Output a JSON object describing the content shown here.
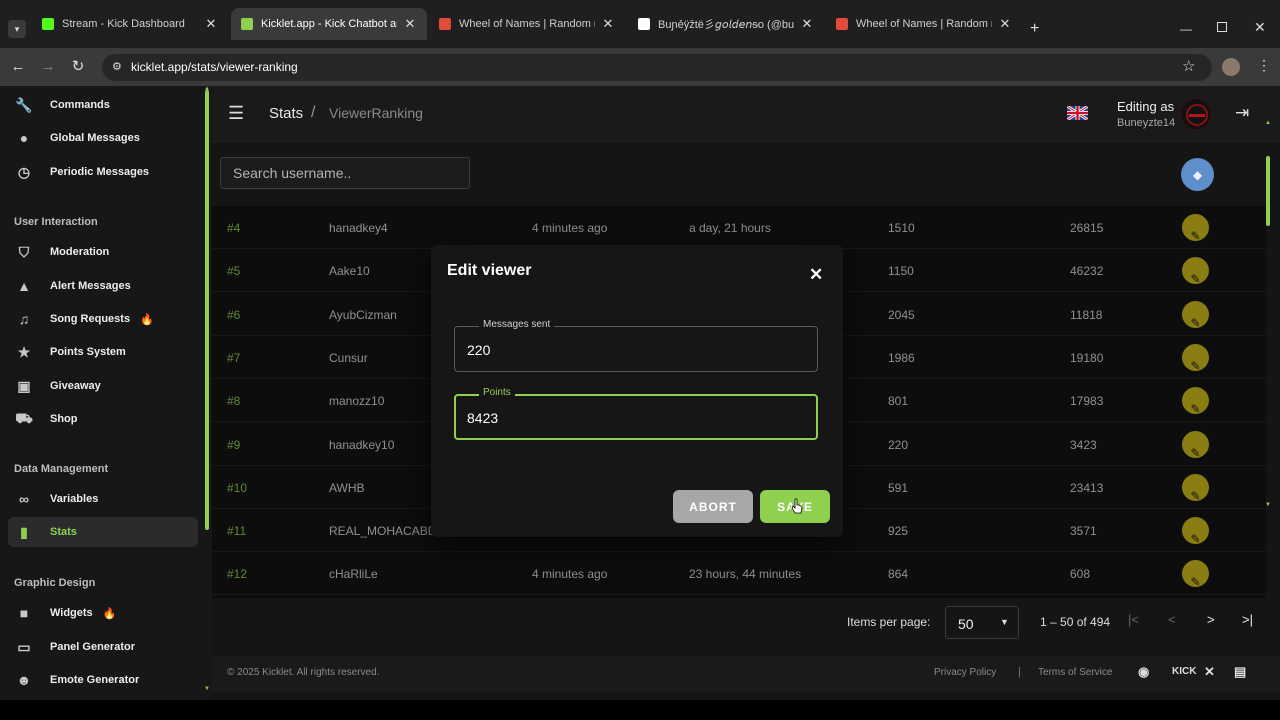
{
  "browser": {
    "tabs": [
      {
        "title": "Stream - Kick Dashboard",
        "favicon_color": "#53fc18"
      },
      {
        "title": "Kicklet.app - Kick Chatbot and C",
        "favicon_color": "#8fd14f"
      },
      {
        "title": "Wheel of Names | Random nam",
        "favicon_color": "#e04b3c"
      },
      {
        "title": "Buɲẻÿžtë彡𝘨𝘰𝘭𝘥𝘦𝘯ᵴo (@buneyz",
        "favicon_color": "#ffffff"
      },
      {
        "title": "Wheel of Names | Random nam",
        "favicon_color": "#e04b3c"
      }
    ],
    "url": "kicklet.app/stats/viewer-ranking"
  },
  "sidebar": {
    "items_top": [
      {
        "label": "Commands",
        "icon": "wrench-icon"
      },
      {
        "label": "Global Messages",
        "icon": "chat-icon"
      },
      {
        "label": "Periodic Messages",
        "icon": "clock-icon"
      }
    ],
    "section_interaction": "User Interaction",
    "items_interaction": [
      {
        "label": "Moderation",
        "icon": "shield-icon"
      },
      {
        "label": "Alert Messages",
        "icon": "warning-icon"
      },
      {
        "label": "Song Requests",
        "icon": "music-icon"
      },
      {
        "label": "Points System",
        "icon": "star-icon"
      },
      {
        "label": "Giveaway",
        "icon": "gift-icon"
      },
      {
        "label": "Shop",
        "icon": "cart-icon"
      }
    ],
    "section_data": "Data Management",
    "items_data": [
      {
        "label": "Variables",
        "icon": "link-icon"
      },
      {
        "label": "Stats",
        "icon": "bar-chart-icon"
      }
    ],
    "section_design": "Graphic Design",
    "items_design": [
      {
        "label": "Widgets",
        "icon": "video-icon"
      },
      {
        "label": "Panel Generator",
        "icon": "panel-icon"
      },
      {
        "label": "Emote Generator",
        "icon": "smile-icon"
      }
    ],
    "accent": "#8fd14f"
  },
  "header": {
    "crumb_root": "Stats",
    "crumb_sep": "/",
    "crumb_current": "ViewerRanking",
    "editing_as": "Editing as",
    "username": "Buneyzte14"
  },
  "search": {
    "placeholder": "Search username.."
  },
  "table": {
    "rows": [
      {
        "rank": "#4",
        "user": "hanadkey4",
        "last": "4 minutes ago",
        "watch": "a day, 21 hours",
        "msgs": "1510",
        "pts": "26815"
      },
      {
        "rank": "#5",
        "user": "Aake10",
        "last": "",
        "watch": "",
        "msgs": "1150",
        "pts": "46232"
      },
      {
        "rank": "#6",
        "user": "AyubCizman",
        "last": "",
        "watch": "",
        "msgs": "2045",
        "pts": "11818"
      },
      {
        "rank": "#7",
        "user": "Cunsur",
        "last": "",
        "watch": "",
        "msgs": "1986",
        "pts": "19180"
      },
      {
        "rank": "#8",
        "user": "manozz10",
        "last": "",
        "watch": "",
        "msgs": "801",
        "pts": "17983"
      },
      {
        "rank": "#9",
        "user": "hanadkey10",
        "last": "",
        "watch": "",
        "msgs": "220",
        "pts": "3423"
      },
      {
        "rank": "#10",
        "user": "AWHB",
        "last": "",
        "watch": "",
        "msgs": "591",
        "pts": "23413"
      },
      {
        "rank": "#11",
        "user": "REAL_MOHACABDI",
        "last": "",
        "watch": "",
        "msgs": "925",
        "pts": "3571"
      },
      {
        "rank": "#12",
        "user": "cHaRliLe",
        "last": "4 minutes ago",
        "watch": "23 hours, 44 minutes",
        "msgs": "864",
        "pts": "608"
      }
    ]
  },
  "paginator": {
    "items_per_page_label": "Items per page:",
    "items_per_page": "50",
    "range": "1 – 50 of 494"
  },
  "footer": {
    "copyright": "© 2025 Kicklet. All rights reserved.",
    "privacy": "Privacy Policy",
    "sep": "|",
    "terms": "Terms of Service",
    "kick": "KICK"
  },
  "modal": {
    "title": "Edit viewer",
    "messages_label": "Messages sent",
    "messages_value": "220",
    "points_label": "Points",
    "points_value": "8423",
    "abort": "ABORT",
    "save": "SAVE"
  }
}
